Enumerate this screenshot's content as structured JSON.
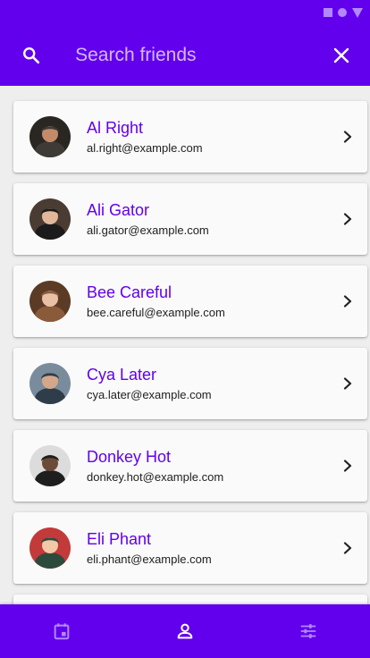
{
  "colors": {
    "primary": "#6200ee",
    "name_text": "#6200ee",
    "card_bg": "#fafafa",
    "page_bg": "#eeeeee",
    "nav_inactive": "#b388ff",
    "nav_active": "#ffffff"
  },
  "status_bar": {
    "icons": [
      "square-icon",
      "circle-icon",
      "triangle-icon"
    ]
  },
  "app_bar": {
    "search_icon": "search-icon",
    "search_placeholder": "Search friends",
    "search_value": "",
    "close_icon": "close-icon"
  },
  "friends": [
    {
      "name": "Al Right",
      "email": "al.right@example.com",
      "avatar": "avatar-photo"
    },
    {
      "name": "Ali Gator",
      "email": "ali.gator@example.com",
      "avatar": "avatar-photo"
    },
    {
      "name": "Bee Careful",
      "email": "bee.careful@example.com",
      "avatar": "avatar-photo"
    },
    {
      "name": "Cya Later",
      "email": "cya.later@example.com",
      "avatar": "avatar-photo"
    },
    {
      "name": "Donkey Hot",
      "email": "donkey.hot@example.com",
      "avatar": "avatar-photo"
    },
    {
      "name": "Eli Phant",
      "email": "eli.phant@example.com",
      "avatar": "avatar-photo"
    }
  ],
  "bottom_nav": {
    "items": [
      {
        "icon": "calendar-icon",
        "active": false
      },
      {
        "icon": "person-icon",
        "active": true
      },
      {
        "icon": "tune-icon",
        "active": false
      }
    ]
  }
}
